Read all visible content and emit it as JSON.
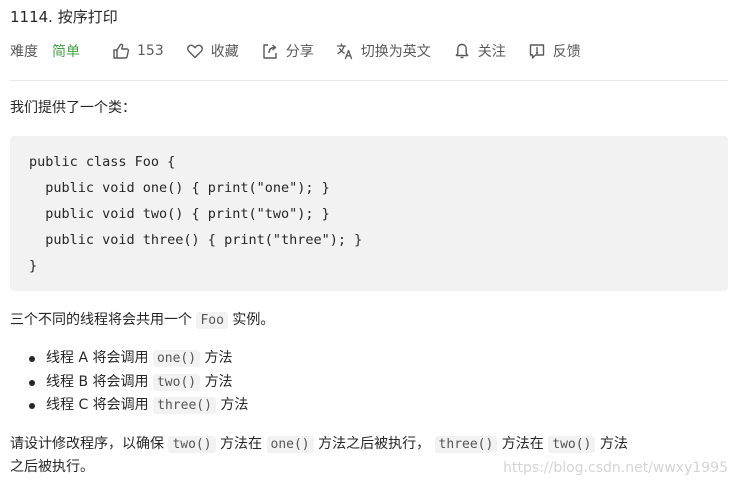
{
  "title": "1114. 按序打印",
  "toolbar": {
    "difficulty_label": "难度",
    "difficulty_value": "简单",
    "likes_count": "153",
    "favorite_label": "收藏",
    "share_label": "分享",
    "translate_label": "切换为英文",
    "follow_label": "关注",
    "feedback_label": "反馈"
  },
  "description": {
    "intro": "我们提供了一个类：",
    "code_lines": [
      "public class Foo {",
      "  public void one() { print(\"one\"); }",
      "  public void two() { print(\"two\"); }",
      "  public void three() { print(\"three\"); }",
      "}"
    ],
    "shared_sentence": {
      "before": "三个不同的线程将会共用一个",
      "code": "Foo",
      "after": "实例。"
    },
    "bullets": [
      {
        "before": "线程 A 将会调用",
        "code": "one()",
        "after": "方法"
      },
      {
        "before": "线程 B 将会调用",
        "code": "two()",
        "after": "方法"
      },
      {
        "before": "线程 C 将会调用",
        "code": "three()",
        "after": "方法"
      }
    ],
    "design": {
      "p1": "请设计修改程序，以确保",
      "c1": "two()",
      "p2": "方法在",
      "c2": "one()",
      "p3": "方法之后被执行，",
      "c3": "three()",
      "p4": "方法在",
      "c4": "two()",
      "p5": "方法",
      "line2": "之后被执行。"
    }
  },
  "watermark": "https://blog.csdn.net/wwxy1995",
  "colors": {
    "difficulty_easy": "#43a047",
    "code_background": "#f2f2f2",
    "text": "#262626",
    "muted": "#595959"
  }
}
